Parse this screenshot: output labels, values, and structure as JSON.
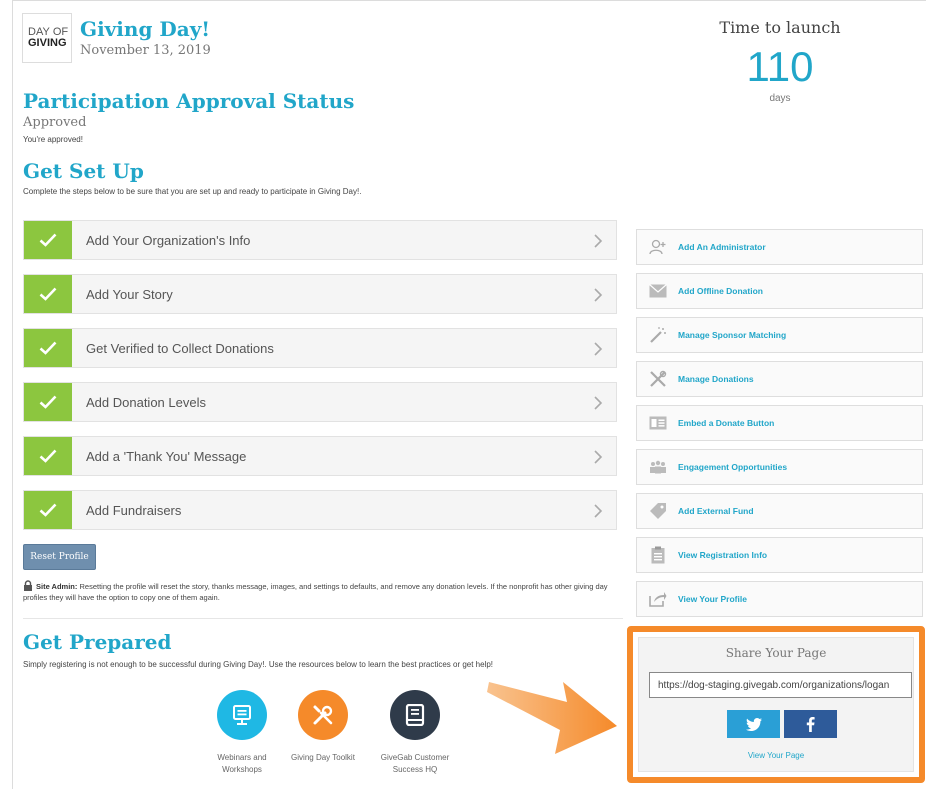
{
  "header": {
    "logo_line1": "DAY",
    "logo_line1b": "OF",
    "logo_line2": "GIVING",
    "event_title": "Giving Day!",
    "event_date": "November 13, 2019"
  },
  "countdown": {
    "label": "Time to launch",
    "value": "110",
    "unit": "days"
  },
  "approval": {
    "heading": "Participation Approval Status",
    "status": "Approved",
    "message": "You're approved!"
  },
  "setup": {
    "heading": "Get Set Up",
    "description": "Complete the steps below to be sure that you are set up and ready to participate in Giving Day!.",
    "steps": [
      {
        "label": "Add Your Organization's Info",
        "complete": true
      },
      {
        "label": "Add Your Story",
        "complete": true
      },
      {
        "label": "Get Verified to Collect Donations",
        "complete": true
      },
      {
        "label": "Add Donation Levels",
        "complete": true
      },
      {
        "label": "Add a 'Thank You' Message",
        "complete": true
      },
      {
        "label": "Add Fundraisers",
        "complete": true
      }
    ],
    "reset_label": "Reset Profile",
    "admin_label": "Site Admin:",
    "admin_note": "Resetting the profile will reset the story, thanks message, images, and settings to defaults, and remove any donation levels. If the nonprofit has other giving day profiles they will have the option to copy one of them again."
  },
  "actions": [
    {
      "label": "Add An Administrator",
      "icon": "add-user-icon"
    },
    {
      "label": "Add Offline Donation",
      "icon": "envelope-icon"
    },
    {
      "label": "Manage Sponsor Matching",
      "icon": "magic-wand-icon"
    },
    {
      "label": "Manage Donations",
      "icon": "tools-icon"
    },
    {
      "label": "Embed a Donate Button",
      "icon": "embed-icon"
    },
    {
      "label": "Engagement Opportunities",
      "icon": "group-icon"
    },
    {
      "label": "Add External Fund",
      "icon": "tag-icon"
    },
    {
      "label": "View Registration Info",
      "icon": "clipboard-icon"
    },
    {
      "label": "View Your Profile",
      "icon": "share-icon"
    }
  ],
  "prepared": {
    "heading": "Get Prepared",
    "description": "Simply registering is not enough to be successful during Giving Day!. Use the resources below to learn the best practices or get help!",
    "resources": [
      {
        "label_line1": "Webinars and",
        "label_line2": "Workshops",
        "color": "#1fb8e4",
        "icon": "presentation-icon"
      },
      {
        "label_line1": "Giving Day Toolkit",
        "label_line2": "",
        "color": "#f58a2a",
        "icon": "tools-icon"
      },
      {
        "label_line1": "GiveGab Customer",
        "label_line2": "Success HQ",
        "color": "#2f3b4a",
        "icon": "book-icon"
      }
    ]
  },
  "share": {
    "title": "Share Your Page",
    "url": "https://dog-staging.givegab.com/organizations/logan",
    "view_link": "View Your Page"
  },
  "colors": {
    "accent": "#21a6c9",
    "check_green": "#8cc63f",
    "highlight_orange": "#f58a2a",
    "twitter": "#2a9fd6",
    "facebook": "#2e5b9a"
  }
}
